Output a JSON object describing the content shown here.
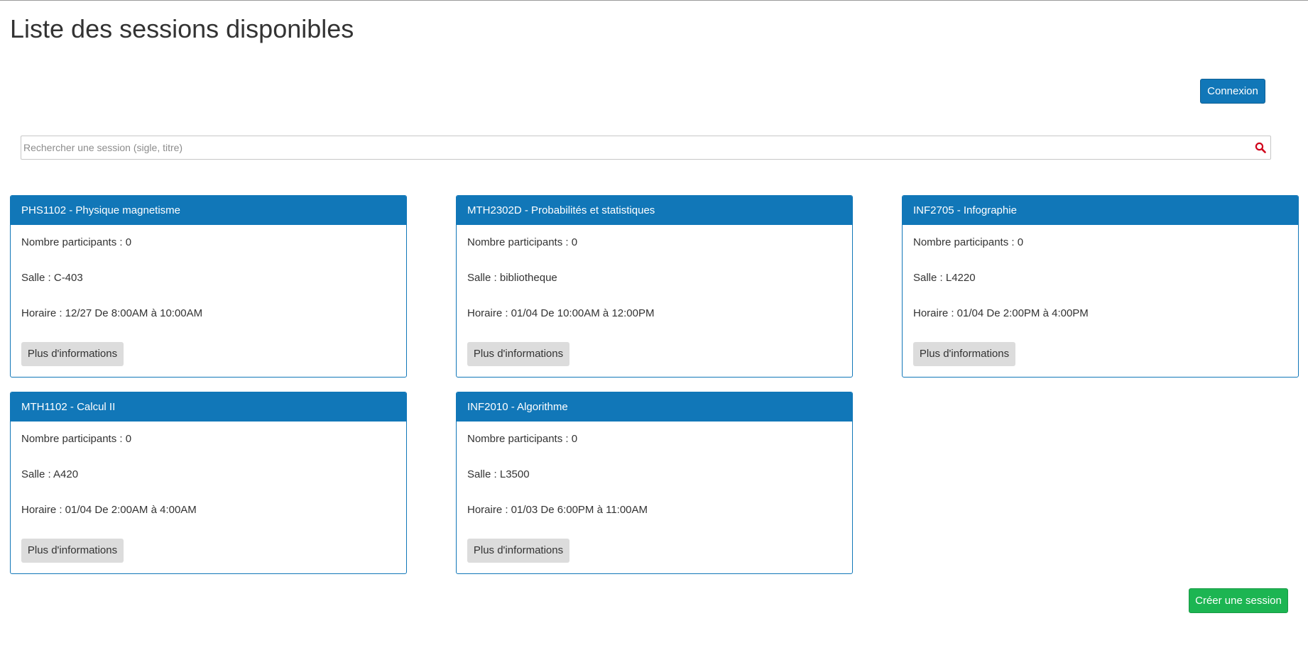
{
  "page": {
    "title": "Liste des sessions disponibles"
  },
  "header": {
    "login_label": "Connexion"
  },
  "search": {
    "placeholder": "Rechercher une session (sigle, titre)",
    "value": "",
    "icon": "search-icon"
  },
  "sessions": [
    {
      "title": "PHS1102 - Physique magnetisme",
      "participants": "Nombre participants : 0",
      "room": "Salle : C-403",
      "schedule": "Horaire : 12/27 De 8:00AM à 10:00AM",
      "button_label": "Plus d'informations"
    },
    {
      "title": "MTH2302D - Probabilités et statistiques",
      "participants": "Nombre participants : 0",
      "room": "Salle : bibliotheque",
      "schedule": "Horaire : 01/04 De 10:00AM à 12:00PM",
      "button_label": "Plus d'informations"
    },
    {
      "title": "INF2705 - Infographie",
      "participants": "Nombre participants : 0",
      "room": "Salle : L4220",
      "schedule": "Horaire : 01/04 De 2:00PM à 4:00PM",
      "button_label": "Plus d'informations"
    },
    {
      "title": "MTH1102 - Calcul II",
      "participants": "Nombre participants : 0",
      "room": "Salle : A420",
      "schedule": "Horaire : 01/04 De 2:00AM à 4:00AM",
      "button_label": "Plus d'informations"
    },
    {
      "title": "INF2010 - Algorithme",
      "participants": "Nombre participants : 0",
      "room": "Salle : L3500",
      "schedule": "Horaire : 01/03 De 6:00PM à 11:00AM",
      "button_label": "Plus d'informations"
    }
  ],
  "footer": {
    "create_label": "Créer une session"
  },
  "colors": {
    "primary": "#1177b8",
    "success": "#1cb552",
    "secondary_button": "#dcdcdc",
    "search_icon": "#d0021b"
  }
}
